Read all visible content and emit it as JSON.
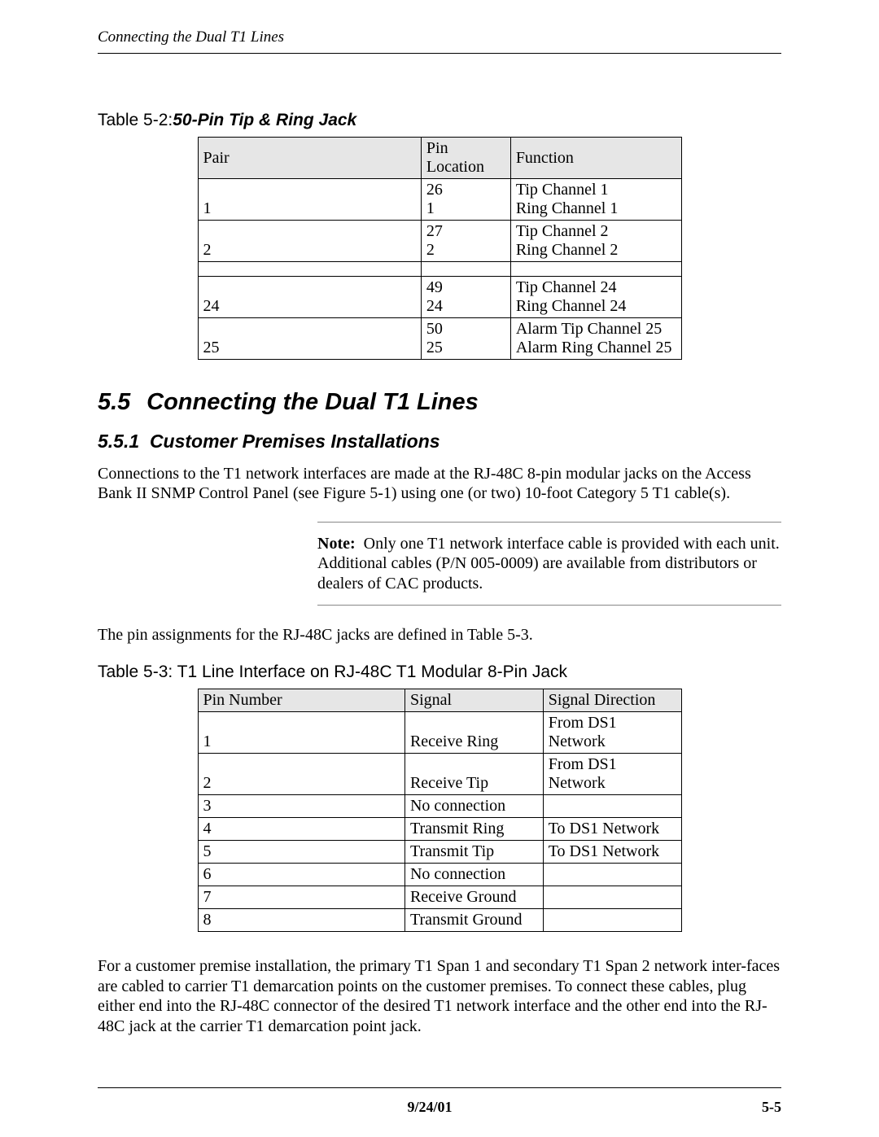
{
  "running_head": "Connecting the Dual T1 Lines",
  "table52": {
    "prefix": "Table 5-2:",
    "title": "50-Pin Tip & Ring Jack",
    "headers": [
      "Pair",
      "Pin Location",
      "Function"
    ],
    "rows": [
      {
        "pair": "1",
        "pins": [
          "26",
          "1"
        ],
        "funcs": [
          "Tip Channel 1",
          "Ring Channel 1"
        ]
      },
      {
        "pair": "2",
        "pins": [
          "27",
          "2"
        ],
        "funcs": [
          "Tip Channel 2",
          "Ring Channel 2"
        ]
      },
      {
        "pair": "24",
        "pins": [
          "49",
          "24"
        ],
        "funcs": [
          "Tip Channel 24",
          "Ring Channel 24"
        ]
      },
      {
        "pair": "25",
        "pins": [
          "50",
          "25"
        ],
        "funcs": [
          "Alarm Tip Channel 25",
          "Alarm Ring Channel 25"
        ]
      }
    ]
  },
  "section": {
    "num": "5.5",
    "title": "Connecting the Dual T1 Lines",
    "sub_num": "5.5.1",
    "sub_title": "Customer Premises Installations"
  },
  "para1": "Connections to the T1 network interfaces are made at the RJ-48C 8-pin modular jacks on the Access Bank II SNMP Control Panel (see Figure 5-1) using one (or two) 10-foot Category 5 T1 cable(s).",
  "note_label": "Note:",
  "note_body": "Only one T1 network interface cable is provided with each unit. Additional cables (P/N 005-0009) are available from distributors or dealers of CAC products.",
  "para2": "The pin assignments for the RJ-48C jacks are defined in Table 5-3.",
  "table53": {
    "caption": "Table 5-3: T1 Line Interface on RJ-48C T1 Modular 8-Pin Jack",
    "headers": [
      "Pin Number",
      "Signal",
      "Signal Direction"
    ],
    "rows": [
      [
        "1",
        "Receive Ring",
        "From DS1 Network"
      ],
      [
        "2",
        "Receive Tip",
        "From DS1 Network"
      ],
      [
        "3",
        "No connection",
        ""
      ],
      [
        "4",
        "Transmit Ring",
        "To DS1 Network"
      ],
      [
        "5",
        "Transmit Tip",
        "To DS1 Network"
      ],
      [
        "6",
        "No connection",
        ""
      ],
      [
        "7",
        "Receive Ground",
        ""
      ],
      [
        "8",
        "Transmit Ground",
        ""
      ]
    ]
  },
  "para3": "For a customer premise installation, the primary T1 Span 1 and secondary T1 Span 2 network inter-faces are cabled to carrier T1 demarcation points on the customer premises. To connect these cables, plug either end into the RJ-48C connector of the desired T1 network interface and the other end into the RJ-48C jack at the carrier T1 demarcation point jack.",
  "footer": {
    "date": "9/24/01",
    "page": "5-5"
  }
}
